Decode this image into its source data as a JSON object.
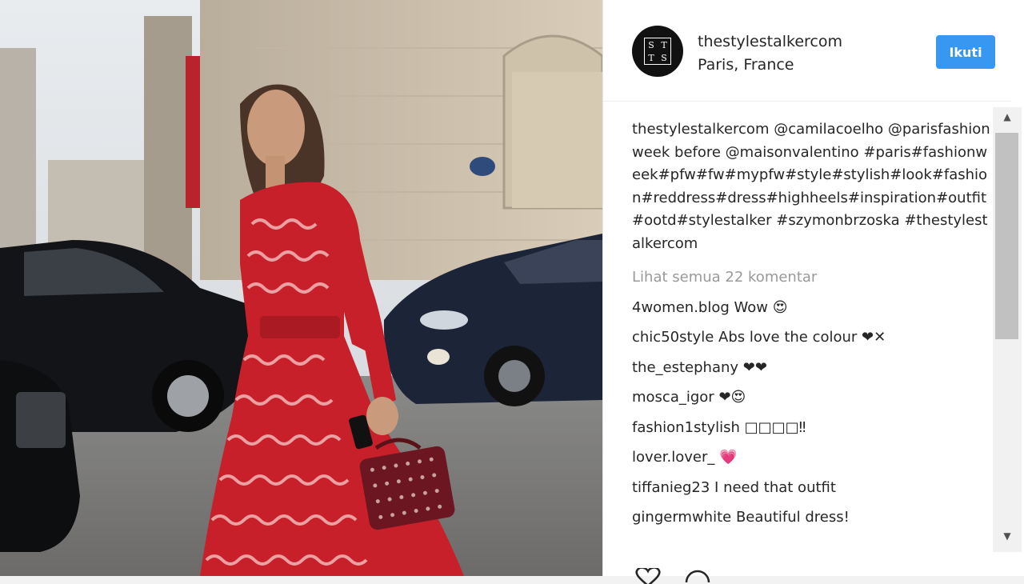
{
  "post": {
    "image_alt": "Street style photo of a woman in a red patterned dress walking in Paris",
    "author": {
      "username": "thestylestalkercom",
      "location": "Paris, France",
      "avatar_letters": [
        "S",
        "T",
        "T",
        "S"
      ]
    },
    "follow_label": "Ikuti",
    "caption": {
      "username": "thestylestalkercom",
      "text": "@camilacoelho @parisfashionweek before @maisonvalentino #paris#fashionweek#pfw#fw#mypfw#style#stylish#look#fashion#reddress#dress#highheels#inspiration#outfit#ootd#stylestalker #szymonbrzoska #thestylestalkercom"
    },
    "view_all": "Lihat semua 22 komentar",
    "comments": [
      {
        "user": "4women.blog",
        "text": "Wow 😍"
      },
      {
        "user": "chic50style",
        "text": "Abs love the colour ❤✕"
      },
      {
        "user": "the_estephany",
        "text": "❤❤"
      },
      {
        "user": "mosca_igor",
        "text": "❤😍"
      },
      {
        "user": "fashion1stylish",
        "text": "□□□□‼"
      },
      {
        "user": "lover.lover_",
        "text": "💗"
      },
      {
        "user": "tiffanieg23",
        "text": "I need that outfit"
      },
      {
        "user": "gingermwhite",
        "text": "Beautiful dress!"
      }
    ]
  },
  "icons": {
    "like": "heart-outline-icon",
    "comment": "comment-bubble-icon",
    "scroll_up": "scroll-up-arrow-icon",
    "scroll_down": "scroll-down-arrow-icon"
  },
  "colors": {
    "follow_button": "#3897f0",
    "dress_red": "#c8202a",
    "muted_text": "#999999"
  }
}
